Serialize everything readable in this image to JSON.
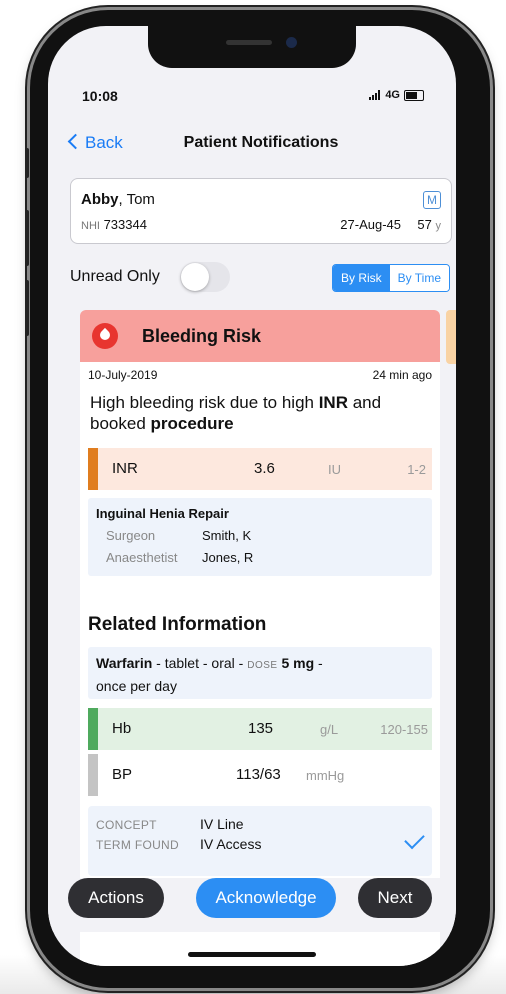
{
  "status_bar": {
    "time": "10:08",
    "network": "4G"
  },
  "nav": {
    "back_label": "Back",
    "title": "Patient Notifications"
  },
  "patient": {
    "surname": "Abby",
    "given": ", Tom",
    "badge": "M",
    "nhi_label": "NHI",
    "nhi": "733344",
    "dob": "27-Aug-45",
    "age": "57",
    "age_unit": "y"
  },
  "filters": {
    "unread_label": "Unread Only",
    "unread_on": false,
    "by_risk": "By Risk",
    "by_time": "By Time",
    "selected": "By Risk"
  },
  "alert": {
    "title": "Bleeding Risk",
    "icon": "blood-drop-icon",
    "date": "10-July-2019",
    "ago": "24 min ago",
    "message_parts": [
      "High bleeding risk due to high ",
      "INR",
      " and booked ",
      "procedure"
    ],
    "inr": {
      "name": "INR",
      "value": "3.6",
      "unit": "IU",
      "range": "1-2"
    },
    "procedure": {
      "title": "Inguinal Henia Repair",
      "surgeon_label": "Surgeon",
      "surgeon": "Smith, K",
      "anaesthetist_label": "Anaesthetist",
      "anaesthetist": "Jones, R"
    }
  },
  "related": {
    "title": "Related Information",
    "med": {
      "name": "Warfarin",
      "form": " - tablet",
      "route": " - oral",
      "sep": " - ",
      "dose_label": "DOSE",
      "dose": "5 mg",
      "freq_sep": " -",
      "frequency": "once per day"
    },
    "hb": {
      "name": "Hb",
      "value": "135",
      "unit": "g/L",
      "range": "120-155"
    },
    "bp": {
      "name": "BP",
      "value": "113/63",
      "unit": "mmHg"
    },
    "concept": {
      "concept_label": "CONCEPT",
      "concept": "IV Line",
      "term_label": "TERM FOUND",
      "term": "IV Access"
    }
  },
  "actions": {
    "actions": "Actions",
    "acknowledge": "Acknowledge",
    "next": "Next"
  },
  "colors": {
    "accent": "#2c8ef3",
    "risk_header": "#f7a09c",
    "inr_bar": "#e07d1f",
    "hb_bar": "#4faa5e",
    "bp_bar": "#c4c4c4"
  }
}
